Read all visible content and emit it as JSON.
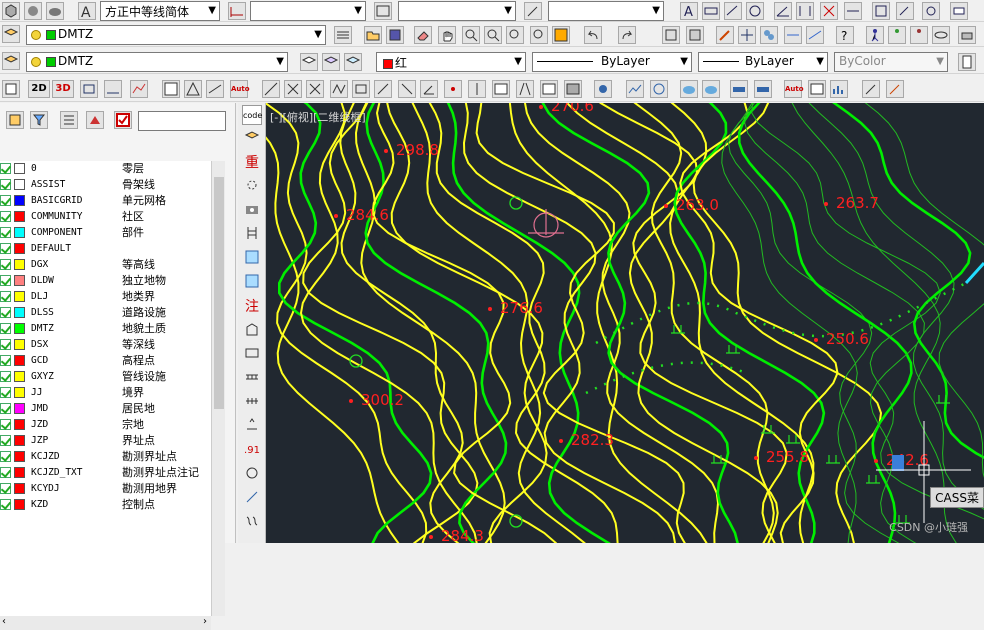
{
  "toolbar1": {
    "font_name": "方正中等线简体"
  },
  "toolbar2": {
    "layer_combo": "DMTZ"
  },
  "toolbar3": {
    "layer_combo": "DMTZ",
    "color_combo": "红",
    "linetype1": "ByLayer",
    "linetype2": "ByLayer",
    "plotstyle": "ByColor"
  },
  "toolbar4": {
    "btn_2d": "2D",
    "btn_3d": "3D"
  },
  "layers": [
    {
      "name": "0",
      "cn": "零层",
      "color": "#ffffff"
    },
    {
      "name": "ASSIST",
      "cn": "骨架线",
      "color": "#ffffff"
    },
    {
      "name": "BASICGRID",
      "cn": "单元网格",
      "color": "#0000ff"
    },
    {
      "name": "COMMUNITY",
      "cn": "社区",
      "color": "#ff0000"
    },
    {
      "name": "COMPONENT",
      "cn": "部件",
      "color": "#00ffff"
    },
    {
      "name": "DEFAULT",
      "cn": "",
      "color": "#ff0000"
    },
    {
      "name": "DGX",
      "cn": "等高线",
      "color": "#ffff00"
    },
    {
      "name": "DLDW",
      "cn": "独立地物",
      "color": "#ff8080"
    },
    {
      "name": "DLJ",
      "cn": "地类界",
      "color": "#ffff00"
    },
    {
      "name": "DLSS",
      "cn": "道路设施",
      "color": "#00ffff"
    },
    {
      "name": "DMTZ",
      "cn": "地貌土质",
      "color": "#00ff00"
    },
    {
      "name": "DSX",
      "cn": "等深线",
      "color": "#ffff00"
    },
    {
      "name": "GCD",
      "cn": "高程点",
      "color": "#ff0000"
    },
    {
      "name": "GXYZ",
      "cn": "管线设施",
      "color": "#ffff00"
    },
    {
      "name": "JJ",
      "cn": "境界",
      "color": "#ffff00"
    },
    {
      "name": "JMD",
      "cn": "居民地",
      "color": "#ff00ff"
    },
    {
      "name": "JZD",
      "cn": "宗地",
      "color": "#ff0000"
    },
    {
      "name": "JZP",
      "cn": "界址点",
      "color": "#ff0000"
    },
    {
      "name": "KCJZD",
      "cn": "勘测界址点",
      "color": "#ff0000"
    },
    {
      "name": "KCJZD_TXT",
      "cn": "勘测界址点注记",
      "color": "#ff0000"
    },
    {
      "name": "KCYDJ",
      "cn": "勘测用地界",
      "color": "#ff0000"
    },
    {
      "name": "KZD",
      "cn": "控制点",
      "color": "#ff0000"
    }
  ],
  "vtools": {
    "zhong": "重",
    "zhu": "注",
    "code": "code",
    "n91": ".91"
  },
  "viewport": {
    "label": "[-][俯视][二维线框]"
  },
  "elevations": [
    {
      "text": "298.8"
    },
    {
      "text": "284.6"
    },
    {
      "text": "276.6"
    },
    {
      "text": "263.0"
    },
    {
      "text": "263.7"
    },
    {
      "text": "250.6"
    },
    {
      "text": "300.2"
    },
    {
      "text": "282.3"
    },
    {
      "text": "255.8"
    },
    {
      "text": "284.3"
    },
    {
      "text": "270.6"
    },
    {
      "text": "242.6"
    }
  ],
  "status": {
    "cass": "CASS菜",
    "watermark": "CSDN @小琏强"
  },
  "colors": {
    "contour_main": "#00ee00",
    "contour_minor": "#ffff20",
    "elevation": "#ff2020",
    "canvas": "#212830"
  }
}
